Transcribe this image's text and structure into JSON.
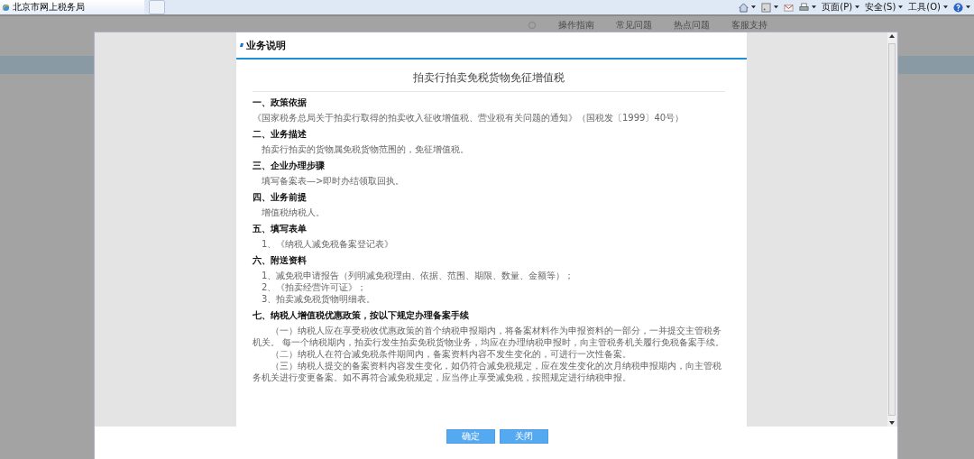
{
  "browser": {
    "tab_title": "北京市网上税务局",
    "commands": [
      {
        "kind": "home",
        "dropdown": true
      },
      {
        "kind": "feed",
        "dropdown": true
      },
      {
        "kind": "mail",
        "dropdown": false
      },
      {
        "kind": "print",
        "dropdown": true
      },
      {
        "kind": "menu",
        "label": "页面(P)",
        "dropdown": true
      },
      {
        "kind": "menu",
        "label": "安全(S)",
        "dropdown": true
      },
      {
        "kind": "menu",
        "label": "工具(O)",
        "dropdown": true
      },
      {
        "kind": "help",
        "dropdown": true
      }
    ]
  },
  "page": {
    "nav": [
      "操作指南",
      "常见问题",
      "热点问题",
      "客服支持"
    ]
  },
  "dialog": {
    "title": "业务说明",
    "doc_title": "拍卖行拍卖免税货物免征增值税",
    "sections": [
      {
        "heading": "一、政策依据",
        "lines": [
          {
            "kind": "flush",
            "text": "《国家税务总局关于拍卖行取得的拍卖收入征收增值税、营业税有关问题的通知》（国税发〔1999〕40号）"
          }
        ]
      },
      {
        "heading": "二、业务描述",
        "lines": [
          {
            "kind": "indented",
            "text": "拍卖行拍卖的货物属免税货物范围的，免征增值税。"
          }
        ]
      },
      {
        "heading": "三、企业办理步骤",
        "lines": [
          {
            "kind": "indented",
            "text": "填写备案表—>即时办结领取回执。"
          }
        ]
      },
      {
        "heading": "四、业务前提",
        "lines": [
          {
            "kind": "indented",
            "text": "增值税纳税人。"
          }
        ]
      },
      {
        "heading": "五、填写表单",
        "lines": [
          {
            "kind": "indented",
            "text": "1、《纳税人减免税备案登记表》"
          }
        ]
      },
      {
        "heading": "六、附送资料",
        "lines": [
          {
            "kind": "indented",
            "text": "1、减免税申请报告（列明减免税理由、依据、范围、期限、数量、金额等）；"
          },
          {
            "kind": "indented",
            "text": "2、《拍卖经营许可证》；"
          },
          {
            "kind": "indented",
            "text": "3、拍卖减免税货物明细表。"
          }
        ]
      },
      {
        "heading": "七、纳税人增值税优惠政策，按以下规定办理备案手续",
        "lines": [
          {
            "kind": "paragraph",
            "text": "（一）纳税人应在享受税收优惠政策的首个纳税申报期内，将备案材料作为申报资料的一部分，一并提交主管税务机关。 每一个纳税期内，拍卖行发生拍卖免税货物业务，均应在办理纳税申报时，向主管税务机关履行免税备案手续。"
          },
          {
            "kind": "paragraph",
            "text": "（二）纳税人在符合减免税条件期间内，备案资料内容不发生变化的，可进行一次性备案。"
          },
          {
            "kind": "paragraph",
            "text": "（三）纳税人提交的备案资料内容发生变化，如仍符合减免税规定，应在发生变化的次月纳税申报期内，向主管税务机关进行变更备案。如不再符合减免税规定，应当停止享受减免税，按照规定进行纳税申报。"
          }
        ]
      }
    ],
    "buttons": [
      "确定",
      "关闭"
    ]
  }
}
